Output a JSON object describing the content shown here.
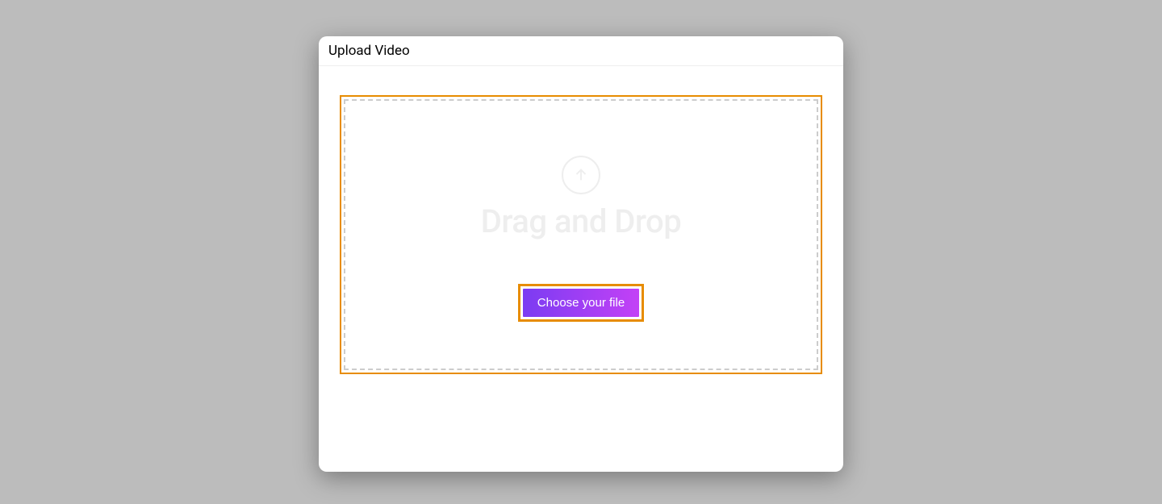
{
  "dialog": {
    "title": "Upload Video",
    "dropzone_text": "Drag and Drop",
    "choose_button_label": "Choose your file"
  },
  "colors": {
    "highlight": "#e78c00",
    "button_gradient_start": "#7b3cf2",
    "button_gradient_end": "#c341f6"
  }
}
